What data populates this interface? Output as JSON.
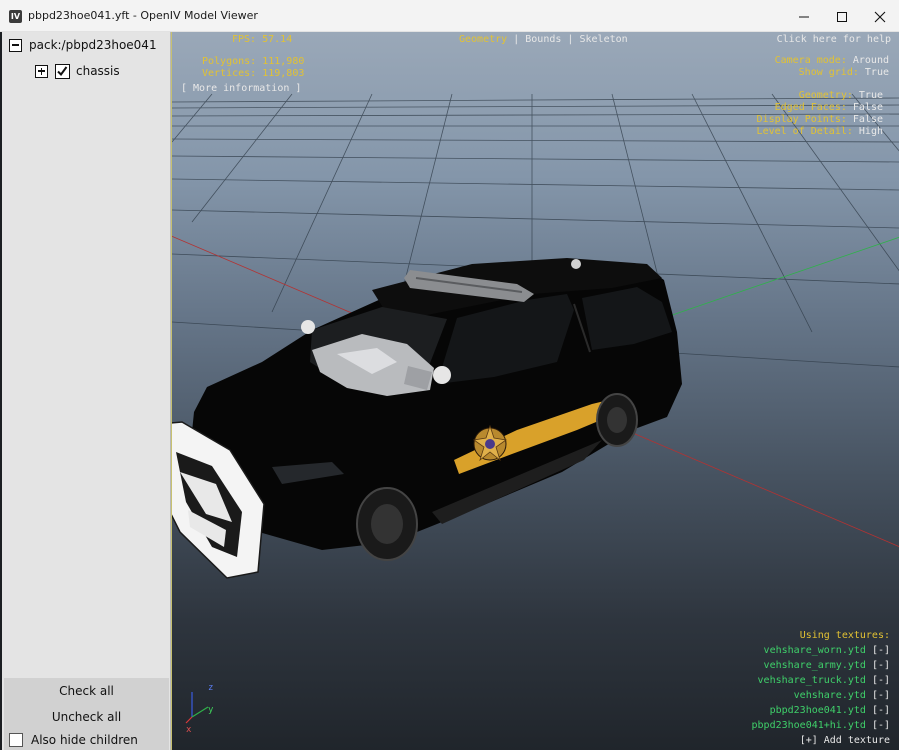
{
  "window": {
    "title": "pbpd23hoe041.yft - OpenIV Model Viewer",
    "icon_label": "IV"
  },
  "tree": {
    "root_label": "pack:/pbpd23hoe041",
    "child_label": "chassis"
  },
  "panel": {
    "check_all": "Check all",
    "uncheck_all": "Uncheck all",
    "hide_children": "Also hide children"
  },
  "hud": {
    "fps_label": "FPS:",
    "fps_value": "57.14",
    "polygons_label": "Polygons:",
    "polygons_value": "111,980",
    "vertices_label": "Vertices:",
    "vertices_value": "119,803",
    "more_info": "[ More information ]",
    "modes": [
      "Geometry",
      "Bounds",
      "Skeleton"
    ],
    "separator": "|",
    "help": "Click here for help",
    "camera_mode_label": "Camera mode:",
    "camera_mode_value": "Around",
    "show_grid_label": "Show grid:",
    "show_grid_value": "True",
    "geometry_label": "Geometry:",
    "geometry_value": "True",
    "edged_faces_label": "Edged Faces:",
    "edged_faces_value": "False",
    "display_points_label": "Display Points:",
    "display_points_value": "False",
    "lod_label": "Level of Detail:",
    "lod_value": "High"
  },
  "textures": {
    "heading": "Using textures:",
    "items": [
      {
        "name": "vehshare_worn.ytd",
        "action": "[-]"
      },
      {
        "name": "vehshare_army.ytd",
        "action": "[-]"
      },
      {
        "name": "vehshare_truck.ytd",
        "action": "[-]"
      },
      {
        "name": "vehshare.ytd",
        "action": "[-]"
      },
      {
        "name": "pbpd23hoe041.ytd",
        "action": "[-]"
      },
      {
        "name": "pbpd23hoe041+hi.ytd",
        "action": "[-]"
      }
    ],
    "add": "[+] Add texture"
  },
  "gizmo": {
    "z": "z",
    "y": "y",
    "x": "x"
  },
  "colors": {
    "hud_yellow": "#e2c233",
    "texture_green": "#3fd06a",
    "car_body": "#060606",
    "stripe_gold": "#d9a12a"
  }
}
